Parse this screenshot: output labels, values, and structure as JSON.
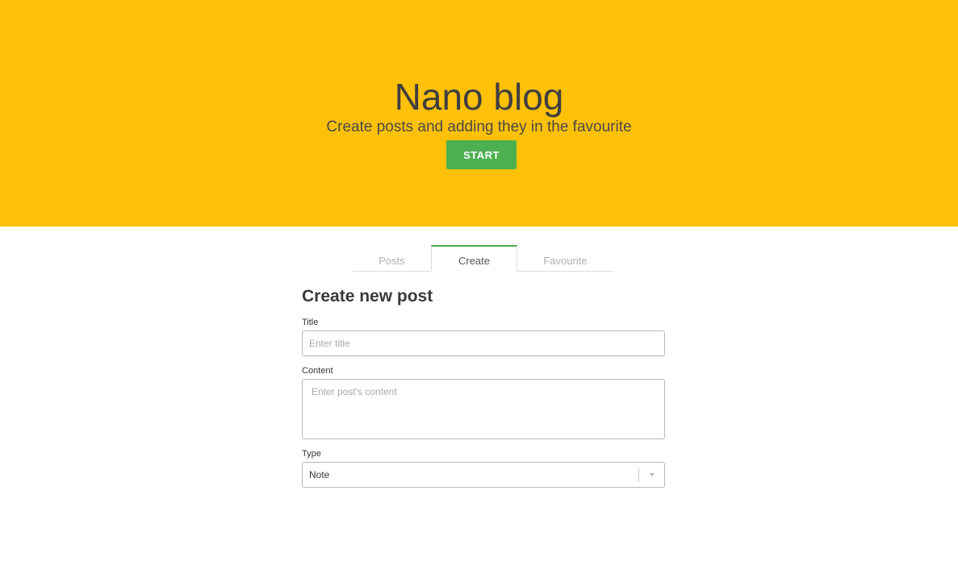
{
  "hero": {
    "title": "Nano blog",
    "subtitle": "Create posts and adding they in the favourite",
    "start_label": "START",
    "background_color": "#ffc107",
    "button_color": "#4caf50"
  },
  "tabs": [
    {
      "label": "Posts",
      "active": false
    },
    {
      "label": "Create",
      "active": true
    },
    {
      "label": "Favourite",
      "active": false
    }
  ],
  "form": {
    "heading": "Create new post",
    "title_label": "Title",
    "title_placeholder": "Enter title",
    "title_value": "",
    "content_label": "Content",
    "content_placeholder": "Enter post's content",
    "content_value": "",
    "type_label": "Type",
    "type_value": "Note"
  },
  "icons": {
    "select_arrow": "chevron-down-icon"
  }
}
